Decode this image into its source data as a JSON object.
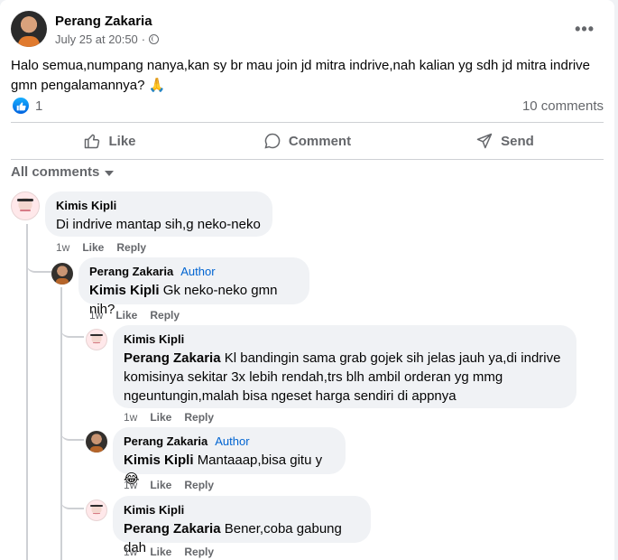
{
  "post": {
    "author": "Perang Zakaria",
    "timestamp": "July 25 at 20:50",
    "separator": "·",
    "text": "Halo semua,numpang nanya,kan sy br mau join jd mitra indrive,nah kalian yg sdh jd mitra indrive gmn pengalamannya? 🙏",
    "like_count": "1",
    "comment_count": "10 comments",
    "more_icon": "more-horizontal-icon"
  },
  "actions": {
    "like": "Like",
    "comment": "Comment",
    "send": "Send"
  },
  "comments_filter": "All comments",
  "comments": [
    {
      "name": "Kimis Kipli",
      "badge": "",
      "mention": "",
      "text": "Di indrive mantap sih,g neko-neko",
      "time": "1w",
      "like": "Like",
      "reply": "Reply"
    },
    {
      "name": "Perang Zakaria",
      "badge": "Author",
      "mention": "Kimis Kipli",
      "text": "Gk neko-neko gmn nih?",
      "time": "1w",
      "like": "Like",
      "reply": "Reply"
    },
    {
      "name": "Kimis Kipli",
      "badge": "",
      "mention": "Perang Zakaria",
      "text": "Kl bandingin sama grab gojek sih jelas jauh ya,di indrive komisinya sekitar 3x lebih rendah,trs blh ambil orderan yg mmg ngeuntungin,malah bisa ngeset harga sendiri di appnya",
      "time": "1w",
      "like": "Like",
      "reply": "Reply"
    },
    {
      "name": "Perang Zakaria",
      "badge": "Author",
      "mention": "Kimis Kipli",
      "text": "Mantaaap,bisa gitu y 😂",
      "time": "1w",
      "like": "Like",
      "reply": "Reply"
    },
    {
      "name": "Kimis Kipli",
      "badge": "",
      "mention": "Perang Zakaria",
      "text": "Bener,coba gabung dah",
      "time": "1w",
      "like": "Like",
      "reply": "Reply"
    }
  ]
}
